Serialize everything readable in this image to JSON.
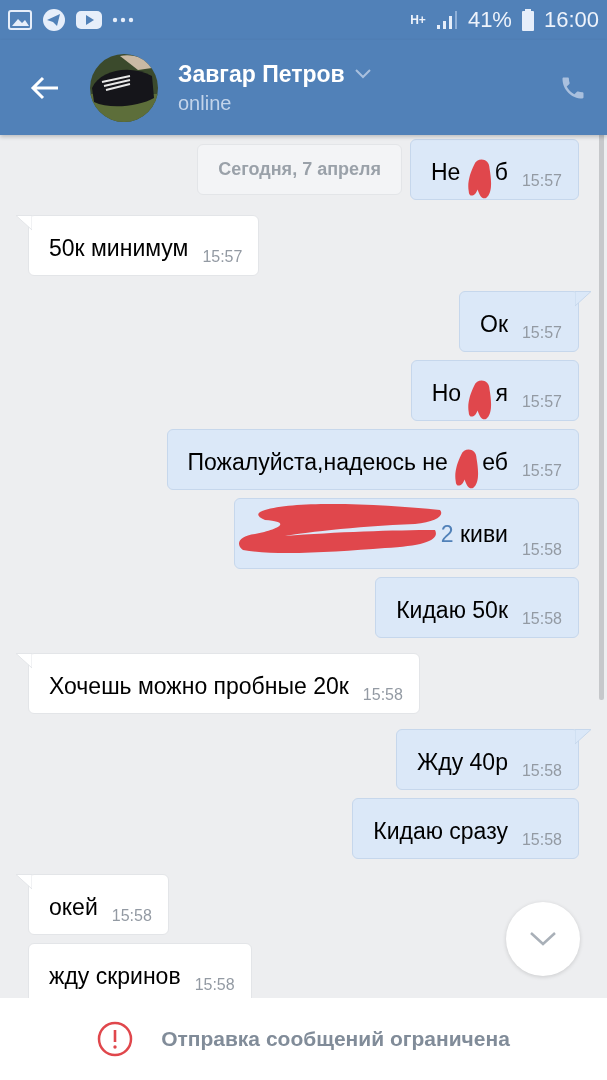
{
  "status_bar": {
    "network": "H+",
    "battery": "41%",
    "time": "16:00"
  },
  "header": {
    "name": "Завгар Петров",
    "status": "online"
  },
  "date_divider": "Сегодня, 7 апреля",
  "messages": [
    {
      "kind": "outgoing",
      "tail": false,
      "time": "15:57",
      "segments": [
        {
          "kind": "text",
          "text": "Не "
        },
        {
          "kind": "scribble"
        },
        {
          "kind": "text",
          "text": "б"
        }
      ]
    },
    {
      "kind": "incoming",
      "tail": true,
      "time": "15:57",
      "segments": [
        {
          "kind": "text",
          "text": "50к минимум"
        }
      ]
    },
    {
      "kind": "outgoing",
      "tail": true,
      "time": "15:57",
      "segments": [
        {
          "kind": "text",
          "text": "Ок"
        }
      ]
    },
    {
      "kind": "outgoing",
      "tail": false,
      "time": "15:57",
      "segments": [
        {
          "kind": "text",
          "text": "Но "
        },
        {
          "kind": "scribble"
        },
        {
          "kind": "text",
          "text": "я"
        }
      ]
    },
    {
      "kind": "outgoing",
      "tail": false,
      "time": "15:57",
      "segments": [
        {
          "kind": "text",
          "text": "Пожалуйста,надеюсь не "
        },
        {
          "kind": "scribble"
        },
        {
          "kind": "text",
          "text": "еб"
        }
      ]
    },
    {
      "kind": "outgoing",
      "tail": false,
      "time": "15:58",
      "segments": [
        {
          "kind": "long_scribble"
        },
        {
          "kind": "link",
          "text": "2"
        },
        {
          "kind": "text",
          "text": " киви"
        }
      ]
    },
    {
      "kind": "outgoing",
      "tail": false,
      "time": "15:58",
      "segments": [
        {
          "kind": "text",
          "text": "Кидаю 50к"
        }
      ]
    },
    {
      "kind": "incoming",
      "tail": true,
      "time": "15:58",
      "segments": [
        {
          "kind": "text",
          "text": "Хочешь можно пробные 20к"
        }
      ]
    },
    {
      "kind": "outgoing",
      "tail": true,
      "time": "15:58",
      "segments": [
        {
          "kind": "text",
          "text": "Жду 40р"
        }
      ]
    },
    {
      "kind": "outgoing",
      "tail": false,
      "time": "15:58",
      "segments": [
        {
          "kind": "text",
          "text": "Кидаю сразу"
        }
      ]
    },
    {
      "kind": "incoming",
      "tail": true,
      "time": "15:58",
      "segments": [
        {
          "kind": "text",
          "text": "окей"
        }
      ]
    },
    {
      "kind": "incoming",
      "tail": false,
      "time": "15:58",
      "segments": [
        {
          "kind": "text",
          "text": "жду скринов"
        }
      ]
    }
  ],
  "footer": {
    "notice": "Отправка сообщений ограничена"
  }
}
